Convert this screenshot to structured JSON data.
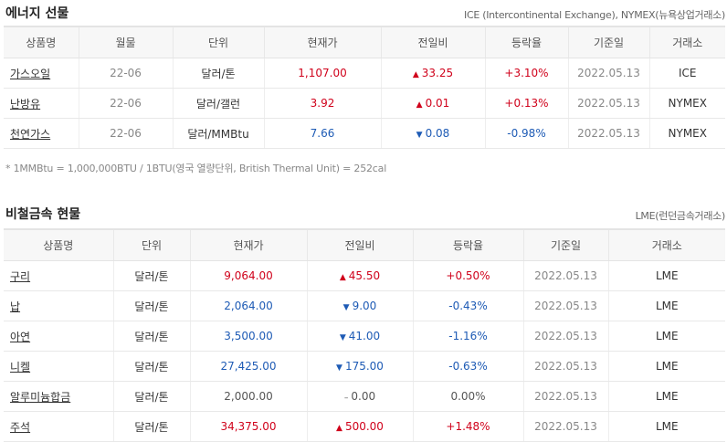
{
  "energy": {
    "title": "에너지 선물",
    "source": "ICE (Intercontinental Exchange), NYMEX(뉴욕상업거래소)",
    "headers": [
      "상품명",
      "월물",
      "단위",
      "현재가",
      "전일비",
      "등락율",
      "기준일",
      "거래소"
    ],
    "rows": [
      {
        "name": "가스오일",
        "month": "22-06",
        "unit": "달러/톤",
        "price": "1,107.00",
        "change": "33.25",
        "dir": "up",
        "rate": "+3.10%",
        "date": "2022.05.13",
        "exchange": "ICE"
      },
      {
        "name": "난방유",
        "month": "22-06",
        "unit": "달러/갤런",
        "price": "3.92",
        "change": "0.01",
        "dir": "up",
        "rate": "+0.13%",
        "date": "2022.05.13",
        "exchange": "NYMEX"
      },
      {
        "name": "천연가스",
        "month": "22-06",
        "unit": "달러/MMBtu",
        "price": "7.66",
        "change": "0.08",
        "dir": "down",
        "rate": "-0.98%",
        "date": "2022.05.13",
        "exchange": "NYMEX"
      }
    ],
    "note": "* 1MMBtu = 1,000,000BTU / 1BTU(영국 열량단위, British Thermal Unit) = 252cal"
  },
  "metals": {
    "title": "비철금속 현물",
    "source": "LME(런던금속거래소)",
    "headers": [
      "상품명",
      "단위",
      "현재가",
      "전일비",
      "등락율",
      "기준일",
      "거래소"
    ],
    "rows": [
      {
        "name": "구리",
        "unit": "달러/톤",
        "price": "9,064.00",
        "change": "45.50",
        "dir": "up",
        "rate": "+0.50%",
        "date": "2022.05.13",
        "exchange": "LME"
      },
      {
        "name": "납",
        "unit": "달러/톤",
        "price": "2,064.00",
        "change": "9.00",
        "dir": "down",
        "rate": "-0.43%",
        "date": "2022.05.13",
        "exchange": "LME"
      },
      {
        "name": "아연",
        "unit": "달러/톤",
        "price": "3,500.00",
        "change": "41.00",
        "dir": "down",
        "rate": "-1.16%",
        "date": "2022.05.13",
        "exchange": "LME"
      },
      {
        "name": "니켈",
        "unit": "달러/톤",
        "price": "27,425.00",
        "change": "175.00",
        "dir": "down",
        "rate": "-0.63%",
        "date": "2022.05.13",
        "exchange": "LME"
      },
      {
        "name": "알루미늄합금",
        "unit": "달러/톤",
        "price": "2,000.00",
        "change": "0.00",
        "dir": "flat",
        "rate": "0.00%",
        "date": "2022.05.13",
        "exchange": "LME"
      },
      {
        "name": "주석",
        "unit": "달러/톤",
        "price": "34,375.00",
        "change": "500.00",
        "dir": "up",
        "rate": "+1.48%",
        "date": "2022.05.13",
        "exchange": "LME"
      }
    ]
  },
  "colors": {
    "up": "#d0021b",
    "down": "#1e5bb5",
    "flat": "#555555"
  },
  "icons": {
    "up": "triangle-up-icon",
    "down": "triangle-down-icon",
    "flat": "dash-icon"
  }
}
